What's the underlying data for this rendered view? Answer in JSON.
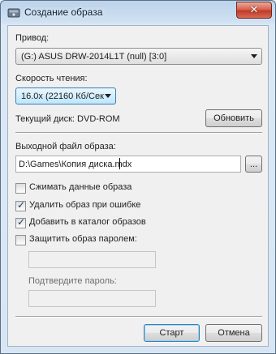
{
  "window": {
    "title": "Создание образа"
  },
  "drive": {
    "label": "Привод:",
    "selected": "(G:) ASUS DRW-2014L1T (null) [3:0]"
  },
  "speed": {
    "label": "Скорость чтения:",
    "selected": "16.0x (22160 Кб/Сек"
  },
  "current_disc": {
    "text": "Текущий диск: DVD-ROM",
    "refresh_label": "Обновить"
  },
  "output": {
    "label": "Выходной файл образа:",
    "value": "D:\\Games\\Копия диска.mdx",
    "browse_label": "..."
  },
  "options": [
    {
      "label": "Сжимать данные образа",
      "checked": false
    },
    {
      "label": "Удалить образ при ошибке",
      "checked": true
    },
    {
      "label": "Добавить в каталог образов",
      "checked": true
    },
    {
      "label": "Защитить образ паролем:",
      "checked": false
    }
  ],
  "password": {
    "value": "",
    "confirm_label": "Подтвердите пароль:",
    "confirm_value": ""
  },
  "footer": {
    "start_label": "Старт",
    "cancel_label": "Отмена"
  },
  "colors": {
    "frame": "#cfe0f1",
    "close_button": "#c0392b",
    "focus_border": "#3c7fb1"
  }
}
